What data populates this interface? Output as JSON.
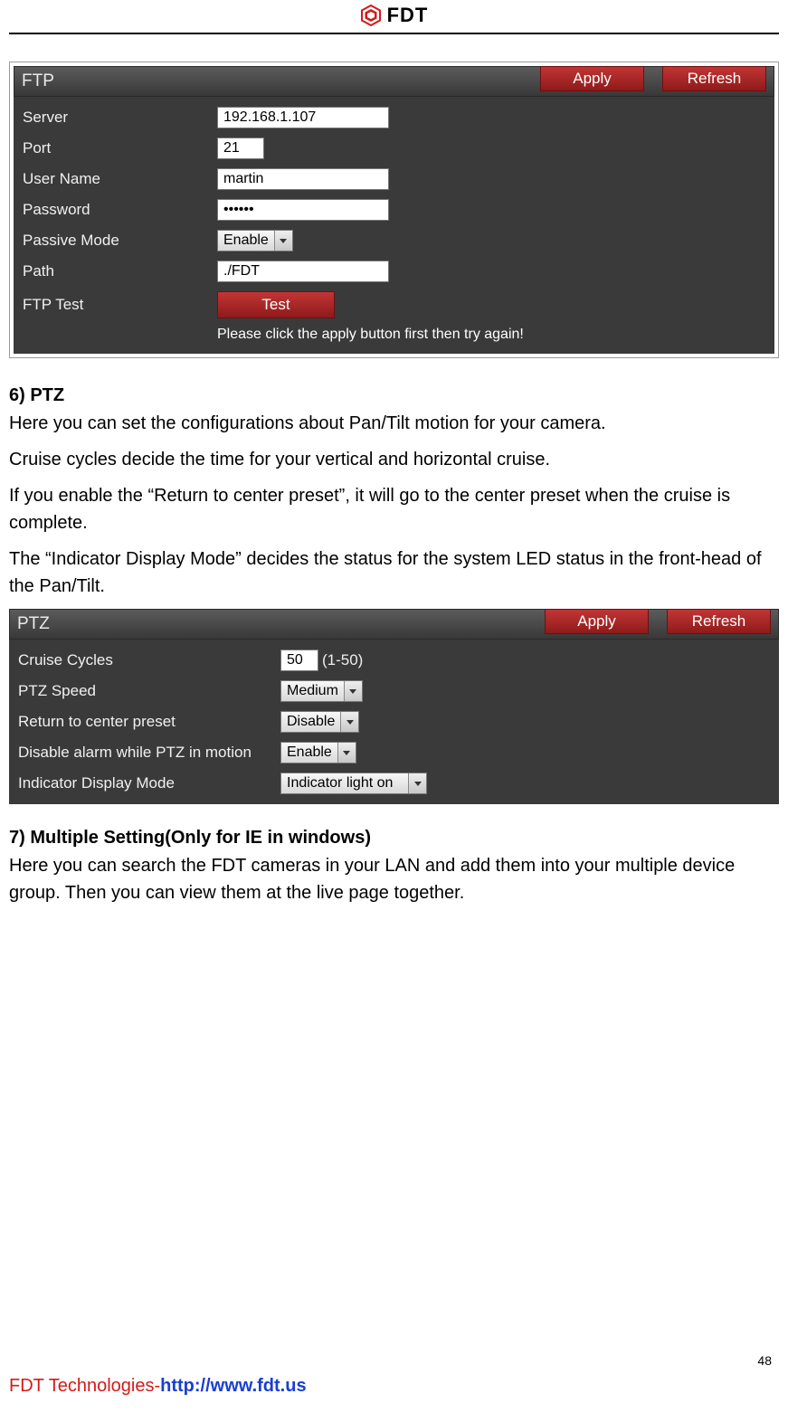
{
  "header": {
    "brand_text": "FDT"
  },
  "ftp_panel": {
    "title": "FTP",
    "apply": "Apply",
    "refresh": "Refresh",
    "rows": {
      "server_label": "Server",
      "server_value": "192.168.1.107",
      "port_label": "Port",
      "port_value": "21",
      "username_label": "User Name",
      "username_value": "martin",
      "password_label": "Password",
      "password_value": "••••••",
      "passive_label": "Passive Mode",
      "passive_value": "Enable",
      "path_label": "Path",
      "path_value": "./FDT",
      "ftptest_label": "FTP Test",
      "test_btn": "Test"
    },
    "hint": "Please click the apply button first then try again!"
  },
  "section_ptz": {
    "heading": "6) PTZ",
    "p1": "Here you can set the configurations about Pan/Tilt motion for your camera.",
    "p2": "Cruise cycles decide the time for your vertical and horizontal cruise.",
    "p3": "If you enable the “Return to center preset”, it will go to the center preset when the cruise is complete.",
    "p4": "The “Indicator Display Mode” decides the status for the system LED status in the front-head of the Pan/Tilt."
  },
  "ptz_panel": {
    "title": "PTZ",
    "apply": "Apply",
    "refresh": "Refresh",
    "rows": {
      "cruise_label": "Cruise Cycles",
      "cruise_value": "50",
      "cruise_range": "(1-50)",
      "speed_label": "PTZ Speed",
      "speed_value": "Medium",
      "return_label": "Return to center preset",
      "return_value": "Disable",
      "disable_alarm_label": "Disable alarm while PTZ in motion",
      "disable_alarm_value": "Enable",
      "indicator_label": "Indicator Display Mode",
      "indicator_value": "Indicator light on"
    }
  },
  "section_multi": {
    "heading": "7) Multiple Setting(Only for IE in windows)",
    "p1": "Here you can search the FDT cameras in your LAN and add them into your multiple device group. Then you can view them at the live page together."
  },
  "footer": {
    "company": "FDT Technologies-",
    "url": "http://www.fdt.us",
    "page_number": "48"
  }
}
